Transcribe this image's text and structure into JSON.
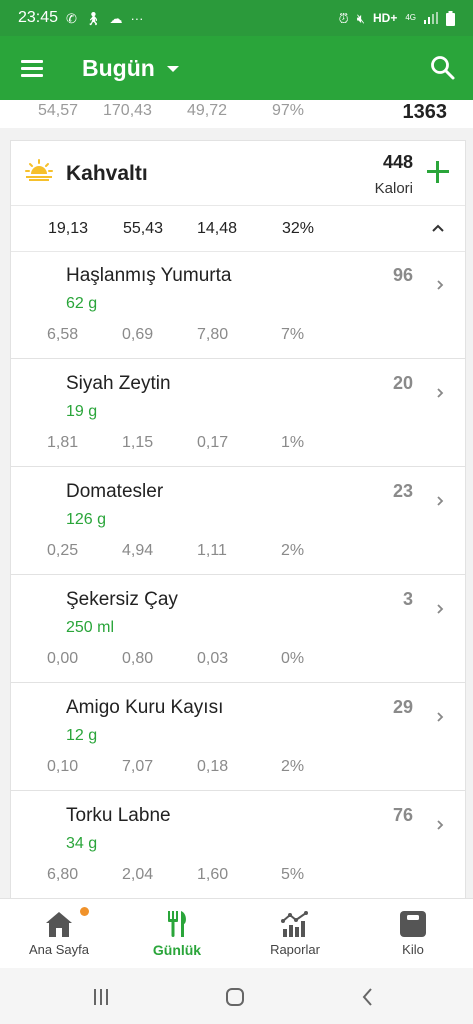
{
  "status_bar": {
    "time": "23:45",
    "network": "HD+",
    "network_sub": "4G"
  },
  "app_bar": {
    "title": "Bugün"
  },
  "summary": {
    "values": [
      "54,57",
      "170,43",
      "49,72",
      "97%"
    ],
    "total": "1363"
  },
  "meal": {
    "title": "Kahvaltı",
    "calories": "448",
    "calories_label": "Kalori",
    "macros": [
      "19,13",
      "55,43",
      "14,48",
      "32%"
    ]
  },
  "foods": [
    {
      "name": "Haşlanmış Yumurta",
      "qty": "62 g",
      "cal": "96",
      "macros": [
        "6,58",
        "0,69",
        "7,80",
        "7%"
      ]
    },
    {
      "name": "Siyah Zeytin",
      "qty": "19 g",
      "cal": "20",
      "macros": [
        "1,81",
        "1,15",
        "0,17",
        "1%"
      ]
    },
    {
      "name": "Domatesler",
      "qty": "126 g",
      "cal": "23",
      "macros": [
        "0,25",
        "4,94",
        "1,11",
        "2%"
      ]
    },
    {
      "name": "Şekersiz Çay",
      "qty": "250 ml",
      "cal": "3",
      "macros": [
        "0,00",
        "0,80",
        "0,03",
        "0%"
      ]
    },
    {
      "name": "Amigo Kuru Kayısı",
      "qty": "12 g",
      "cal": "29",
      "macros": [
        "0,10",
        "7,07",
        "0,18",
        "2%"
      ]
    },
    {
      "name": "Torku Labne",
      "qty": "34  g",
      "cal": "76",
      "macros": [
        "6,80",
        "2,04",
        "1,60",
        "5%"
      ]
    }
  ],
  "bottom_nav": [
    {
      "label": "Ana Sayfa",
      "icon": "home-icon"
    },
    {
      "label": "Günlük",
      "icon": "fork-knife-icon"
    },
    {
      "label": "Raporlar",
      "icon": "reports-icon"
    },
    {
      "label": "Kilo",
      "icon": "scale-icon"
    }
  ],
  "colors": {
    "primary": "#2aa53a",
    "status_bar": "#2b9a3b",
    "notification": "#f0922b"
  }
}
